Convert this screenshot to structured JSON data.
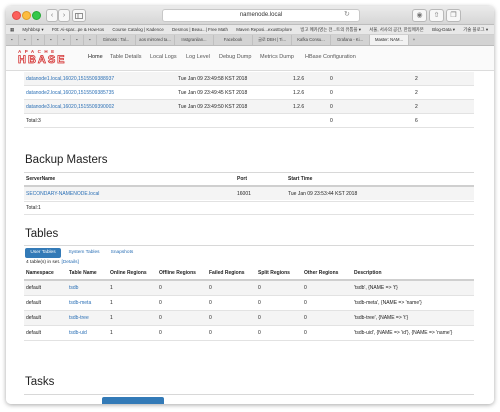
{
  "browser": {
    "url": "namenode.local",
    "bookmarks": [
      "Myhbbsp ▾",
      "F0t: Ai-spar...pe & How-tos",
      "Course Catalog | Kadence",
      "Desmos | Beau...| Free Math",
      "Maven Reposi...exusExplore",
      "빙고 메카(영는 전...트의 유통을 ▾",
      "서울, 서사의 공간, 한입메카본",
      "Blog-Data ▾",
      "기술 블로그 ▾"
    ],
    "tabs": [
      "Gimoss : Tal...",
      "aos mirrored ta...",
      "Instgranilan...",
      "Facebook",
      "글로 DBH | Ti...",
      "Kafka Consu...",
      "Grafana - Ki...",
      "Master: NAM..."
    ],
    "active_tab_index": 7
  },
  "hbase_nav": {
    "logo_top": "APACHE",
    "logo_main": "HBASE",
    "items": [
      "Home",
      "Table Details",
      "Local Logs",
      "Log Level",
      "Debug Dump",
      "Metrics Dump",
      "HBase Configuration"
    ]
  },
  "regionservers": {
    "rows": [
      {
        "name": "datanode1.local,16020,1515509388937",
        "start": "Tue Jan 09 23:49:58 KST 2018",
        "version": "1.2.6",
        "requests": "0",
        "regions": "2"
      },
      {
        "name": "datanode2.local,16020,1515509385735",
        "start": "Tue Jan 09 23:49:45 KST 2018",
        "version": "1.2.6",
        "requests": "0",
        "regions": "2"
      },
      {
        "name": "datanode3.local,16020,1515509390002",
        "start": "Tue Jan 09 23:49:50 KST 2018",
        "version": "1.2.6",
        "requests": "0",
        "regions": "2"
      }
    ],
    "total_label": "Total:3",
    "total_requests": "0",
    "total_regions": "6"
  },
  "backup_masters": {
    "heading": "Backup Masters",
    "headers": {
      "server": "ServerName",
      "port": "Port",
      "start": "Start Time"
    },
    "row": {
      "server": "SECONDARY-NAMENODE.local",
      "port": "16001",
      "start": "Tue Jan 09 23:53:44 KST 2018"
    },
    "total": "Total:1"
  },
  "tables": {
    "heading": "Tables",
    "subtabs": [
      "User Tables",
      "System Tables",
      "Snapshots"
    ],
    "count_text": "4 table(s) in set.",
    "details_link": "[Details]",
    "headers": [
      "Namespace",
      "Table Name",
      "Online Regions",
      "Offline Regions",
      "Failed Regions",
      "Split Regions",
      "Other Regions",
      "Description"
    ],
    "rows": [
      [
        "default",
        "tsdb",
        "1",
        "0",
        "0",
        "0",
        "0",
        "'tsdb', {NAME => 't'}"
      ],
      [
        "default",
        "tsdb-meta",
        "1",
        "0",
        "0",
        "0",
        "0",
        "'tsdb-meta', {NAME => 'name'}"
      ],
      [
        "default",
        "tsdb-tree",
        "1",
        "0",
        "0",
        "0",
        "0",
        "'tsdb-tree', {NAME => 't'}"
      ],
      [
        "default",
        "tsdb-uid",
        "1",
        "0",
        "0",
        "0",
        "0",
        "'tsdb-uid', {NAME => 'id'}, {NAME => 'name'}"
      ]
    ]
  },
  "tasks": {
    "heading": "Tasks"
  },
  "colors": {
    "link": "#2a6fb5",
    "accent": "#337ab7",
    "logo": "#d32f2f"
  }
}
